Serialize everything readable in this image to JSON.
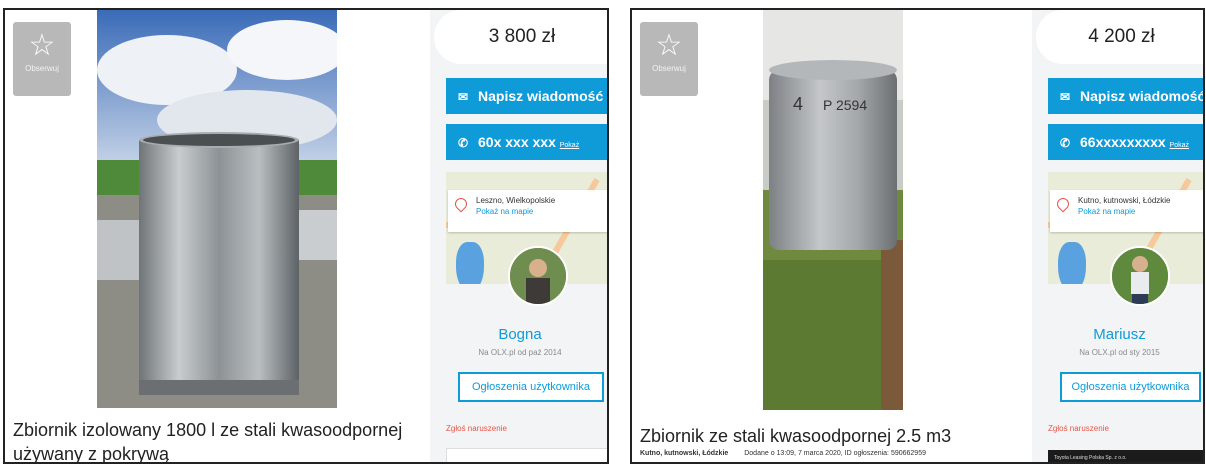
{
  "listings": [
    {
      "observe_label": "Obserwuj",
      "title": "Zbiornik izolowany 1800 l ze stali kwasoodpornej używany z pokrywą",
      "price": "3 800 zł",
      "message_button": "Napisz wiadomość",
      "phone": "60x xxx xxx",
      "phone_show": "Pokaż",
      "location": "Leszno, Wielkopolskie",
      "map_link": "Pokaż na mapie",
      "user_name": "Bogna",
      "user_since": "Na OLX.pl od paź 2014",
      "user_ads_button": "Ogłoszenia użytkownika",
      "report": "Zgłoś naruszenie"
    },
    {
      "observe_label": "Obserwuj",
      "title": "Zbiornik ze stali kwasoodpornej 2.5 m3",
      "meta_location": "Kutno, kutnowski, Łódzkie",
      "meta_details": "Dodane o 13:09, 7 marca 2020, ID ogłoszenia: 590662959",
      "price": "4 200 zł",
      "message_button": "Napisz wiadomość",
      "phone": "66xxxxxxxxx",
      "phone_show": "Pokaż",
      "location": "Kutno, kutnowski, Łódzkie",
      "map_link": "Pokaż na mapie",
      "user_name": "Mariusz",
      "user_since": "Na OLX.pl od sty 2015",
      "user_ads_button": "Ogłoszenia użytkownika",
      "report": "Zgłoś naruszenie",
      "bottom_banner": "Toyota Leasing Polska Sp. z o.o."
    }
  ],
  "colors": {
    "accent_blue": "#0f9bd7",
    "report_red": "#e3574a",
    "sidebar_bg": "#f2f4f5"
  },
  "icons": [
    "star-icon",
    "envelope-icon",
    "phone-icon",
    "map-pin-icon"
  ]
}
